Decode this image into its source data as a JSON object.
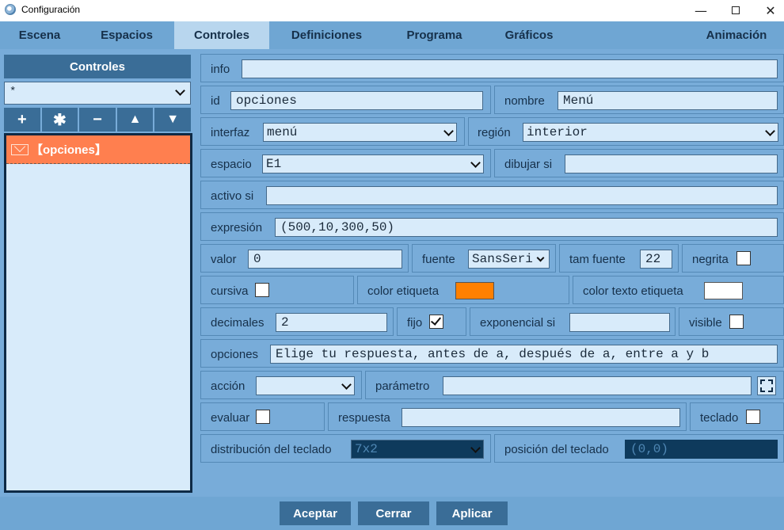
{
  "window": {
    "title": "Configuración"
  },
  "tabs": [
    "Escena",
    "Espacios",
    "Controles",
    "Definiciones",
    "Programa",
    "Gráficos",
    "Animación"
  ],
  "left": {
    "header": "Controles",
    "filter_value": "*",
    "tools": [
      "+",
      "✱",
      "−",
      "▲",
      "▼"
    ],
    "items": [
      "【opciones】"
    ]
  },
  "form": {
    "info": {
      "label": "info",
      "value": ""
    },
    "id": {
      "label": "id",
      "value": "opciones"
    },
    "nombre": {
      "label": "nombre",
      "value": "Menú"
    },
    "interfaz": {
      "label": "interfaz",
      "value": "menú"
    },
    "region": {
      "label": "región",
      "value": "interior"
    },
    "espacio": {
      "label": "espacio",
      "value": "E1"
    },
    "dibujar_si": {
      "label": "dibujar si",
      "value": ""
    },
    "activo_si": {
      "label": "activo si",
      "value": ""
    },
    "expresion": {
      "label": "expresión",
      "value": "(500,10,300,50)"
    },
    "valor": {
      "label": "valor",
      "value": "0"
    },
    "fuente": {
      "label": "fuente",
      "value": "SansSeri"
    },
    "tam_fuente": {
      "label": "tam fuente",
      "value": "22"
    },
    "negrita": {
      "label": "negrita",
      "checked": false
    },
    "cursiva": {
      "label": "cursiva",
      "checked": false
    },
    "color_etiqueta": {
      "label": "color etiqueta",
      "color": "#ff8000"
    },
    "color_texto_etiqueta": {
      "label": "color texto etiqueta",
      "color": "#ffffff"
    },
    "decimales": {
      "label": "decimales",
      "value": "2"
    },
    "fijo": {
      "label": "fijo",
      "checked": true
    },
    "exponencial_si": {
      "label": "exponencial si",
      "value": ""
    },
    "visible": {
      "label": "visible",
      "checked": false
    },
    "opciones": {
      "label": "opciones",
      "value": "Elige tu respuesta, antes de a, después de a, entre a y b"
    },
    "accion": {
      "label": "acción",
      "value": ""
    },
    "parametro": {
      "label": "parámetro",
      "value": ""
    },
    "evaluar": {
      "label": "evaluar",
      "checked": false
    },
    "respuesta": {
      "label": "respuesta",
      "value": ""
    },
    "teclado": {
      "label": "teclado",
      "checked": false
    },
    "distribucion_teclado": {
      "label": "distribución del teclado",
      "value": "7x2"
    },
    "posicion_teclado": {
      "label": "posición del teclado",
      "value": "(0,0)"
    }
  },
  "buttons": {
    "accept": "Aceptar",
    "close": "Cerrar",
    "apply": "Aplicar"
  },
  "colors": {
    "tab_bar": "#6fa6d3",
    "active_tab": "#b8d6ee",
    "panel": "#78acd9",
    "header": "#3a6d97",
    "selected_item": "#ff7f4f",
    "field": "#d8ebfa"
  }
}
